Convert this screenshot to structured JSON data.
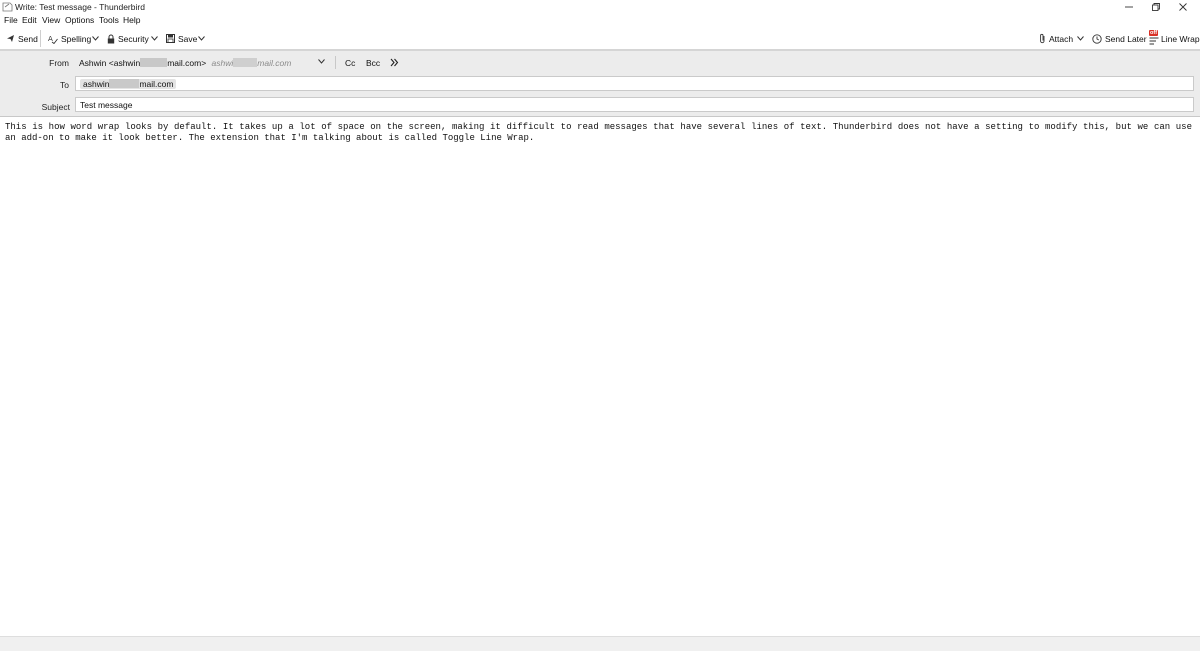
{
  "window": {
    "title": "Write: Test message - Thunderbird",
    "controls": {
      "minimize": "─",
      "restore": "❐",
      "close": "✕"
    }
  },
  "menu": {
    "items": [
      "File",
      "Edit",
      "View",
      "Options",
      "Tools",
      "Help"
    ]
  },
  "toolbar": {
    "send_label": "Send",
    "spelling_label": "Spelling",
    "security_label": "Security",
    "save_label": "Save",
    "attach_label": "Attach",
    "send_later_label": "Send Later",
    "line_wrap_label": "Line Wrap",
    "line_wrap_badge": "off"
  },
  "header": {
    "from_label": "From",
    "from_name_prefix": "Ashwin <ashwin",
    "from_name_suffix": "mail.com>",
    "from_alt_prefix": "ashwi",
    "from_alt_suffix": "mail.com",
    "cc_label": "Cc",
    "bcc_label": "Bcc",
    "more_label": "»",
    "to_label": "To",
    "to_prefix": "ashwin",
    "to_suffix": "mail.com",
    "subject_label": "Subject",
    "subject_value": "Test message"
  },
  "body": {
    "text": "This is how word wrap looks by default. It takes up a lot of space on the screen, making it difficult to read messages that have several lines of text. Thunderbird does not have a setting to modify this, but we can use an add-on to make it look better. The extension that I'm talking about is called Toggle Line Wrap."
  },
  "colors": {
    "header_bg": "#ececec",
    "line_wrap_badge": "#d93025",
    "toolbar_border": "#d5d5d5"
  }
}
